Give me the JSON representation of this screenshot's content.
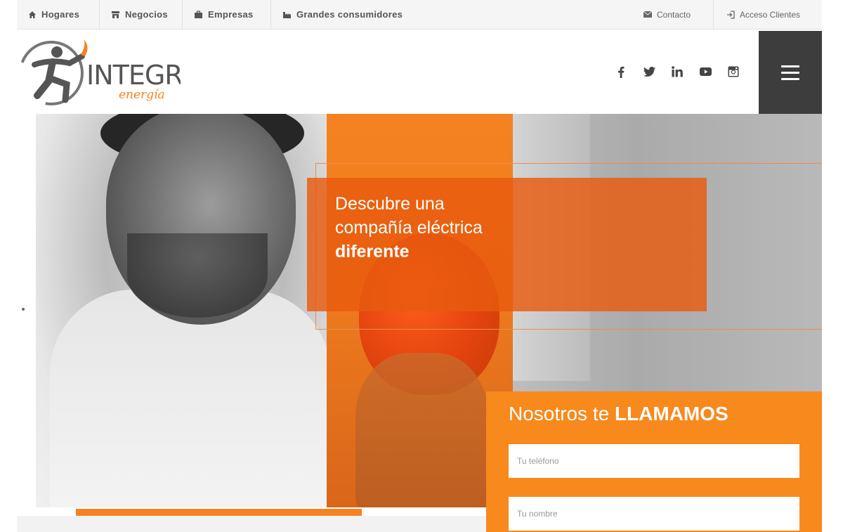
{
  "topnav": {
    "items": [
      {
        "label": "Hogares",
        "icon": "home-icon"
      },
      {
        "label": "Negocios",
        "icon": "store-icon"
      },
      {
        "label": "Empresas",
        "icon": "briefcase-icon"
      },
      {
        "label": "Grandes consumidores",
        "icon": "factory-icon"
      }
    ],
    "contact": {
      "label": "Contacto",
      "icon": "envelope-icon"
    },
    "client_access": {
      "label": "Acceso Clientes",
      "icon": "sign-in-icon"
    }
  },
  "brand": {
    "name": "INTEGRA",
    "tagline": "energía",
    "accent_color": "#f58220"
  },
  "social": [
    {
      "name": "facebook-icon",
      "glyph": "f"
    },
    {
      "name": "twitter-icon",
      "glyph": "t"
    },
    {
      "name": "linkedin-icon",
      "glyph": "in"
    },
    {
      "name": "youtube-icon",
      "glyph": "yt"
    },
    {
      "name": "instagram-icon",
      "glyph": "ig"
    }
  ],
  "hero": {
    "line1": "Descubre una",
    "line2": "compañía eléctrica",
    "line3": "diferente"
  },
  "callback": {
    "title_pre": "Nosotros te",
    "title_strong": "LLAMAMOS",
    "phone_placeholder": "Tu teléfono",
    "name_placeholder": "Tu nombre"
  }
}
